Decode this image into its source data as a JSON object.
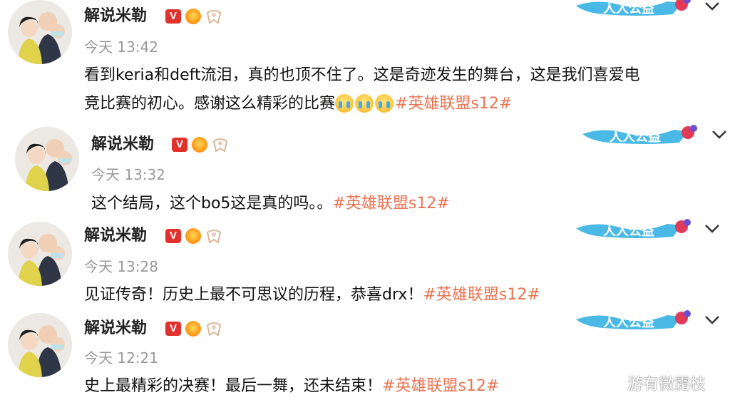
{
  "posts": [
    {
      "author": "解说米勒",
      "time": "今天 13:42",
      "text_line1": "看到keria和deft流泪，真的也顶不住了。这是奇迹发生的舞台，这是我们喜爱电",
      "text_line2": "竞比赛的初心。感谢这么精彩的比赛",
      "emoji_count": 3,
      "hashtag": "#英雄联盟s12#"
    },
    {
      "author": "解说米勒",
      "time": "今天 13:32",
      "text": "这个结局，这个bo5这是真的吗。。",
      "hashtag": "#英雄联盟s12#"
    },
    {
      "author": "解说米勒",
      "time": "今天 13:28",
      "text": "见证传奇！历史上最不可思议的历程，恭喜drx！",
      "hashtag": "#英雄联盟s12#"
    },
    {
      "author": "解说米勒",
      "time": "今天 12:21",
      "text": "史上最精彩的决赛！最后一舞，还未结束！",
      "hashtag": "#英雄联盟s12#"
    }
  ],
  "badges": {
    "verified_letter": "V"
  },
  "banner_text": "人人公益",
  "watermark": "游有微霜枝",
  "colors": {
    "hashtag": "#eb7350",
    "verified": "#e0312c",
    "time": "#999999",
    "banner": "#3fb8e8"
  },
  "icons": [
    "verified-v-icon",
    "fire-medal-icon",
    "ribbon-icon",
    "chevron-down-icon",
    "weibo-icon",
    "crying-emoji-icon"
  ]
}
